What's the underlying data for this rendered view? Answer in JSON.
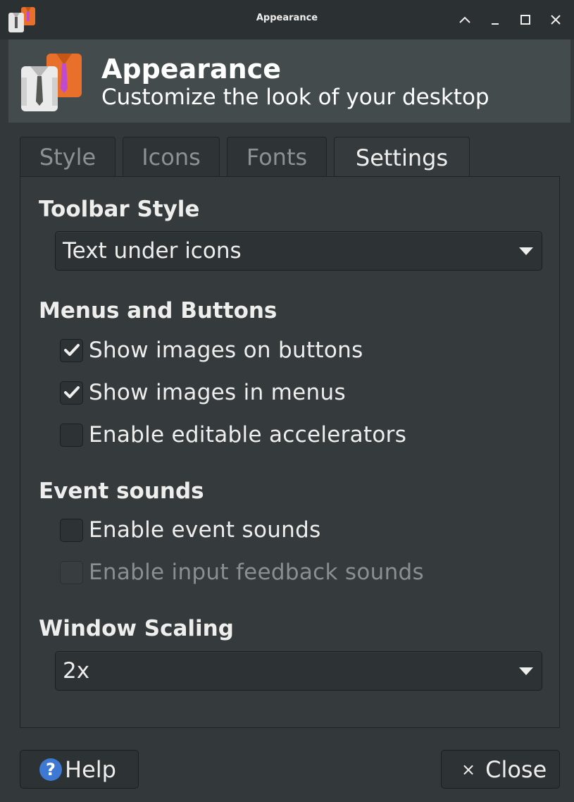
{
  "window": {
    "title": "Appearance"
  },
  "header": {
    "title": "Appearance",
    "subtitle": "Customize the look of your desktop",
    "icon": "appearance-shirts-icon"
  },
  "tabs": [
    {
      "label": "Style",
      "active": false
    },
    {
      "label": "Icons",
      "active": false
    },
    {
      "label": "Fonts",
      "active": false
    },
    {
      "label": "Settings",
      "active": true
    }
  ],
  "settings": {
    "toolbar_style": {
      "heading": "Toolbar Style",
      "selected": "Text under icons"
    },
    "menus_buttons": {
      "heading": "Menus and Buttons",
      "options": [
        {
          "label": "Show images on buttons",
          "checked": true,
          "enabled": true
        },
        {
          "label": "Show images in menus",
          "checked": true,
          "enabled": true
        },
        {
          "label": "Enable editable accelerators",
          "checked": false,
          "enabled": true
        }
      ]
    },
    "event_sounds": {
      "heading": "Event sounds",
      "options": [
        {
          "label": "Enable event sounds",
          "checked": false,
          "enabled": true
        },
        {
          "label": "Enable input feedback sounds",
          "checked": false,
          "enabled": false
        }
      ]
    },
    "window_scaling": {
      "heading": "Window Scaling",
      "selected": "2x"
    }
  },
  "buttons": {
    "help": "Help",
    "close": "Close",
    "close_glyph": "×"
  },
  "colors": {
    "background": "#33393b",
    "accent_help": "#3d78d2"
  }
}
